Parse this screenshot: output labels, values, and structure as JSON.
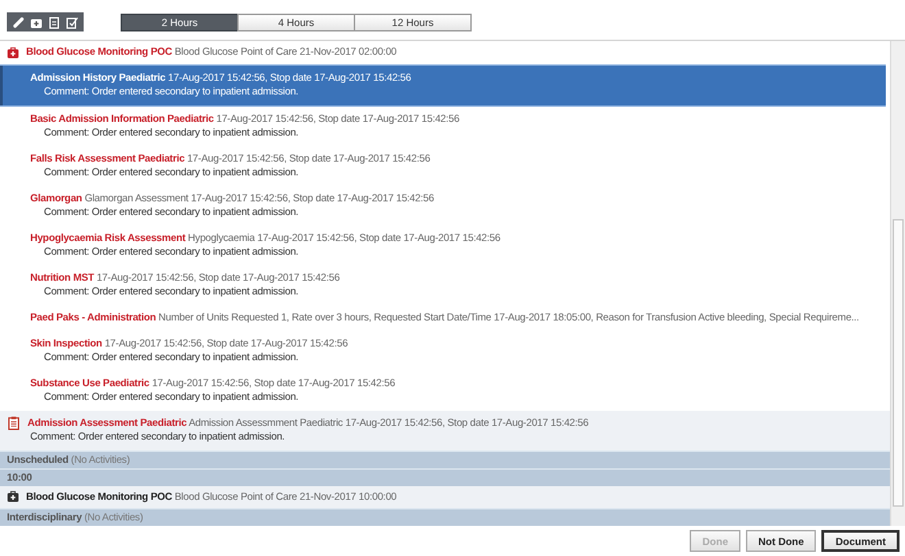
{
  "time_tabs": [
    {
      "label": "2 Hours",
      "selected": true
    },
    {
      "label": "4 Hours",
      "selected": false
    },
    {
      "label": "12 Hours",
      "selected": false
    }
  ],
  "activities": [
    {
      "kind": "task",
      "overdue": true,
      "title": "Blood Glucose Monitoring POC",
      "detail": "Blood Glucose Point of Care 21-Nov-2017 02:00:00"
    },
    {
      "kind": "order",
      "selected": true,
      "title": "Admission History Paediatric",
      "detail": "17-Aug-2017 15:42:56, Stop date 17-Aug-2017 15:42:56",
      "comment": "Comment: Order entered secondary to inpatient admission."
    },
    {
      "kind": "order",
      "selected": false,
      "title": "Basic Admission Information Paediatric",
      "detail": "17-Aug-2017 15:42:56, Stop date 17-Aug-2017 15:42:56",
      "comment": "Comment: Order entered secondary to inpatient admission."
    },
    {
      "kind": "order",
      "selected": false,
      "title": "Falls Risk Assessment Paediatric",
      "detail": "17-Aug-2017 15:42:56, Stop date 17-Aug-2017 15:42:56",
      "comment": "Comment: Order entered secondary to inpatient admission."
    },
    {
      "kind": "order",
      "selected": false,
      "title": "Glamorgan",
      "detail": "Glamorgan Assessment 17-Aug-2017 15:42:56, Stop date 17-Aug-2017 15:42:56",
      "comment": "Comment: Order entered secondary to inpatient admission."
    },
    {
      "kind": "order",
      "selected": false,
      "title": "Hypoglycaemia Risk Assessment",
      "detail": "Hypoglycaemia 17-Aug-2017 15:42:56, Stop date 17-Aug-2017 15:42:56",
      "comment": "Comment: Order entered secondary to inpatient admission."
    },
    {
      "kind": "order",
      "selected": false,
      "title": "Nutrition MST",
      "detail": "17-Aug-2017 15:42:56, Stop date 17-Aug-2017 15:42:56",
      "comment": "Comment: Order entered secondary to inpatient admission."
    },
    {
      "kind": "order",
      "selected": false,
      "title": "Paed Paks - Administration",
      "detail": "Number of Units Requested 1, Rate over 3 hours, Requested Start Date/Time 17-Aug-2017 18:05:00, Reason for Transfusion Active bleeding, Special Requireme..."
    },
    {
      "kind": "order",
      "selected": false,
      "title": "Skin Inspection",
      "detail": "17-Aug-2017 15:42:56, Stop date 17-Aug-2017 15:42:56",
      "comment": "Comment: Order entered secondary to inpatient admission."
    },
    {
      "kind": "order",
      "selected": false,
      "title": "Substance Use Paediatric",
      "detail": "17-Aug-2017 15:42:56, Stop date 17-Aug-2017 15:42:56",
      "comment": "Comment: Order entered secondary to inpatient admission."
    },
    {
      "kind": "assessment",
      "title": "Admission Assessment Paediatric",
      "detail": "Admission Assessmment Paediatric 17-Aug-2017 15:42:56, Stop date 17-Aug-2017 15:42:56",
      "comment": "Comment: Order entered secondary to inpatient admission."
    },
    {
      "kind": "band",
      "title": "Unscheduled",
      "detail": "(No Activities)"
    },
    {
      "kind": "band",
      "title": "10:00"
    },
    {
      "kind": "task",
      "overdue": false,
      "title": "Blood Glucose Monitoring POC",
      "detail": "Blood Glucose Point of Care 21-Nov-2017 10:00:00"
    },
    {
      "kind": "band",
      "title": "Interdisciplinary",
      "detail": "(No Activities)"
    }
  ],
  "buttons": [
    {
      "label": "Done",
      "disabled": true,
      "focused": false
    },
    {
      "label": "Not Done",
      "disabled": false,
      "focused": false
    },
    {
      "label": "Document",
      "disabled": false,
      "focused": true
    }
  ]
}
